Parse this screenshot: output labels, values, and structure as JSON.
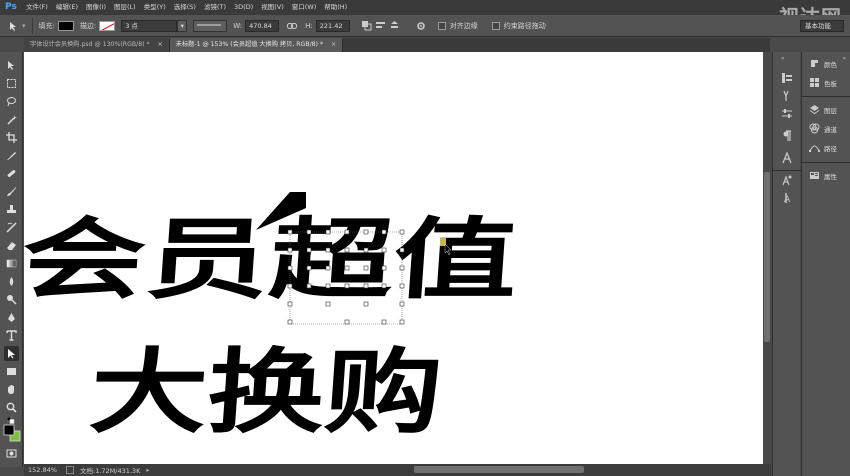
{
  "app": {
    "logo": "Ps",
    "watermark": "视达网"
  },
  "menu": [
    "文件(F)",
    "编辑(E)",
    "图像(I)",
    "图层(L)",
    "类型(Y)",
    "选择(S)",
    "滤镜(T)",
    "3D(D)",
    "视图(V)",
    "窗口(W)",
    "帮助(H)"
  ],
  "options": {
    "fill_label": "填充:",
    "stroke_label": "描边:",
    "stroke_width": "3 点",
    "w_label": "W:",
    "w_value": "470.84",
    "h_label": "H:",
    "h_value": "221.42",
    "align_edges": "对齐边缘",
    "constrain_path": "约束路径拖动",
    "workspace": "基本功能"
  },
  "tabs": [
    {
      "label": "字体设计会员换购.psd @ 130%(RGB/8) *",
      "close": "×"
    },
    {
      "label": "未标题-1 @ 153% (会员超值 大换购 拷贝, RGB/8) *",
      "close": "×"
    }
  ],
  "artwork": {
    "line1": "会员超值",
    "line2": "大换购"
  },
  "status": {
    "zoom": "152.84%",
    "doc_size": "文档:1.72M/431.3K"
  },
  "panels": [
    {
      "label": "颜色",
      "icon": "color-wheel-icon"
    },
    {
      "label": "色板",
      "icon": "swatches-icon"
    },
    {
      "label": "图层",
      "icon": "layers-icon"
    },
    {
      "label": "通道",
      "icon": "channels-icon"
    },
    {
      "label": "路径",
      "icon": "paths-icon"
    },
    {
      "label": "属性",
      "icon": "properties-icon"
    }
  ],
  "colors": {
    "fg": "#000000",
    "bg": "#7cc240",
    "accent": "#4fa8ff"
  }
}
